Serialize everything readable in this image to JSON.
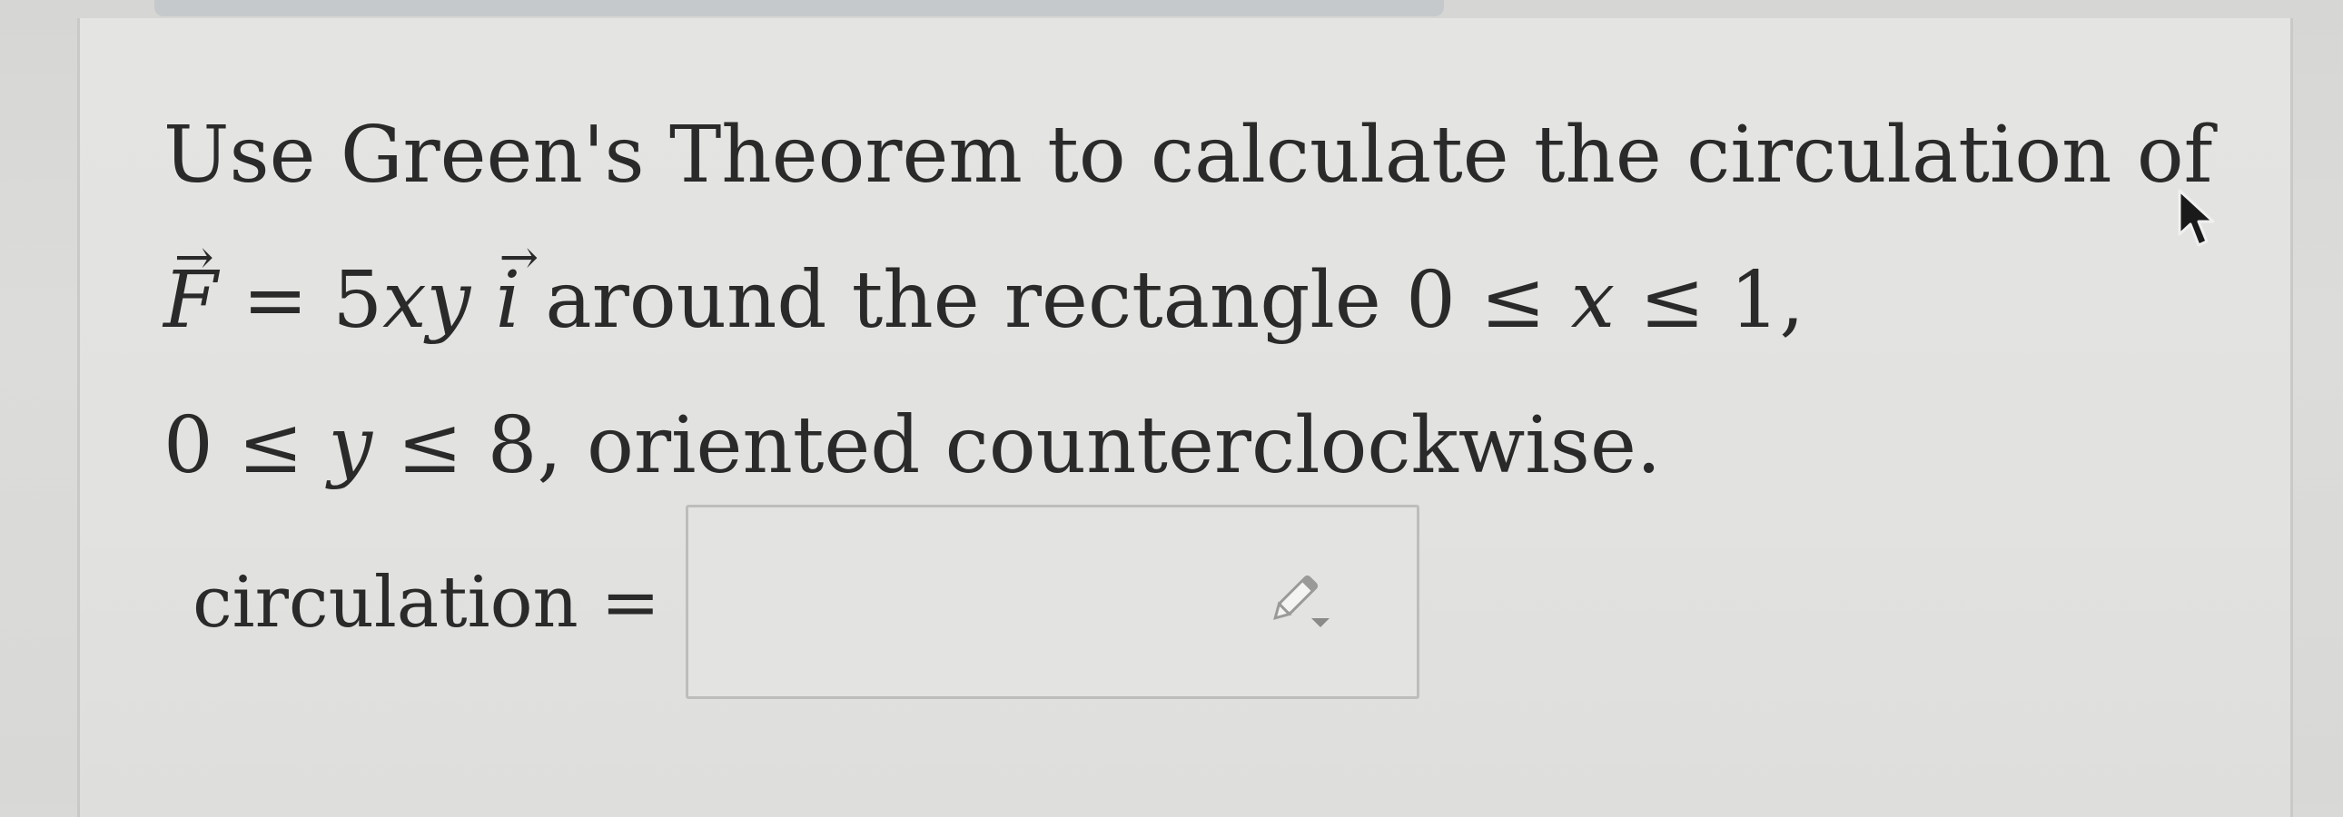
{
  "question": {
    "line1": "Use Green's Theorem to calculate the circulation of",
    "line2": {
      "vector_F": "F",
      "equals": "= 5",
      "vars": "xy",
      "vector_i": "i",
      "text": " around the rectangle 0 ≤ ",
      "x": "x",
      "bound": " ≤ 1,"
    },
    "line3": {
      "lower": "0 ≤ ",
      "y": "y",
      "rest": " ≤ 8, oriented counterclockwise."
    }
  },
  "answer": {
    "label": "circulation =",
    "value": ""
  },
  "icons": {
    "answer_tool": "pencil-dropdown-icon",
    "pointer": "mouse-cursor-icon"
  },
  "colors": {
    "text": "#2a2a2a",
    "background": "#e2e2e0",
    "border": "#bdbdbb"
  }
}
